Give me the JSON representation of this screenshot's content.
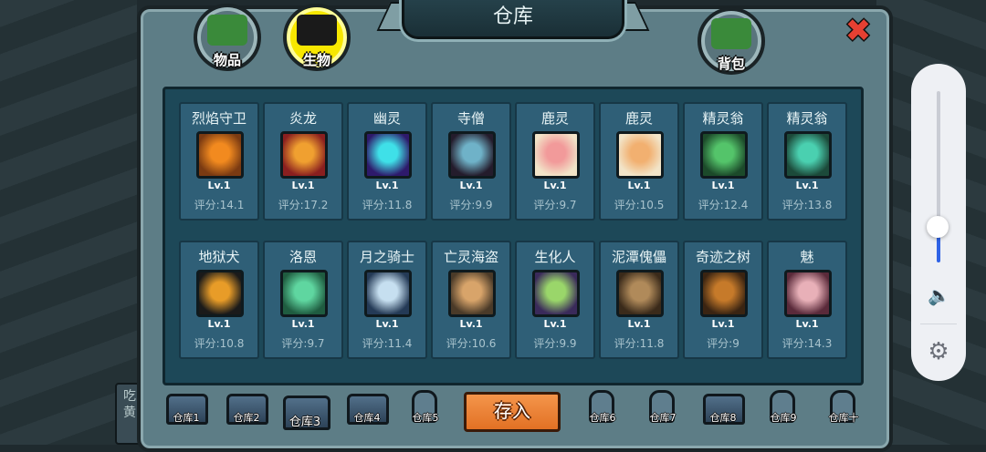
{
  "window": {
    "title": "仓库"
  },
  "tabs": [
    {
      "label": "物品",
      "active": false
    },
    {
      "label": "生物",
      "active": true
    },
    {
      "label": "背包",
      "active": false
    }
  ],
  "side_text": "吃\n黄",
  "creatures": [
    {
      "name": "烈焰守卫",
      "level": "Lv.1",
      "score": "评分:14.1",
      "colors": [
        "#7a3a12",
        "#f28a1f"
      ]
    },
    {
      "name": "炎龙",
      "level": "Lv.1",
      "score": "评分:17.2",
      "colors": [
        "#8a1f1f",
        "#f0a030"
      ]
    },
    {
      "name": "幽灵",
      "level": "Lv.1",
      "score": "评分:11.8",
      "colors": [
        "#2e1a6b",
        "#3fe0e8"
      ]
    },
    {
      "name": "寺僧",
      "level": "Lv.1",
      "score": "评分:9.9",
      "colors": [
        "#241c2c",
        "#6fb2c8"
      ]
    },
    {
      "name": "鹿灵",
      "level": "Lv.1",
      "score": "评分:9.7",
      "colors": [
        "#f2e4c8",
        "#f29a9a"
      ]
    },
    {
      "name": "鹿灵",
      "level": "Lv.1",
      "score": "评分:10.5",
      "colors": [
        "#f2e4c8",
        "#f2b070"
      ]
    },
    {
      "name": "精灵翁",
      "level": "Lv.1",
      "score": "评分:12.4",
      "colors": [
        "#1c4a2a",
        "#54c46a"
      ]
    },
    {
      "name": "精灵翁",
      "level": "Lv.1",
      "score": "评分:13.8",
      "colors": [
        "#1c4a3a",
        "#4ad0b0"
      ]
    },
    {
      "name": "地狱犬",
      "level": "Lv.1",
      "score": "评分:10.8",
      "colors": [
        "#1a1a1a",
        "#e89c28"
      ]
    },
    {
      "name": "洛恩",
      "level": "Lv.1",
      "score": "评分:9.7",
      "colors": [
        "#1f5c40",
        "#5fd6a0"
      ]
    },
    {
      "name": "月之骑士",
      "level": "Lv.1",
      "score": "评分:11.4",
      "colors": [
        "#243a56",
        "#c6dff0"
      ]
    },
    {
      "name": "亡灵海盗",
      "level": "Lv.1",
      "score": "评分:10.6",
      "colors": [
        "#4a3a28",
        "#d8a46a"
      ]
    },
    {
      "name": "生化人",
      "level": "Lv.1",
      "score": "评分:9.9",
      "colors": [
        "#3a2a5a",
        "#9ad66a"
      ]
    },
    {
      "name": "泥潭傀儡",
      "level": "Lv.1",
      "score": "评分:11.8",
      "colors": [
        "#3a2a1a",
        "#b08a5a"
      ]
    },
    {
      "name": "奇迹之树",
      "level": "Lv.1",
      "score": "评分:9",
      "colors": [
        "#3a2412",
        "#c67a2a"
      ]
    },
    {
      "name": "魅",
      "level": "Lv.1",
      "score": "评分:14.3",
      "colors": [
        "#5a2a3a",
        "#e8b0b8"
      ]
    }
  ],
  "storage_tabs": [
    {
      "label": "仓库1",
      "locked": false
    },
    {
      "label": "仓库2",
      "locked": false
    },
    {
      "label": "仓库3",
      "locked": false,
      "active": true
    },
    {
      "label": "仓库4",
      "locked": false
    },
    {
      "label": "仓库5",
      "locked": true
    },
    {
      "label": "仓库6",
      "locked": true
    },
    {
      "label": "仓库7",
      "locked": true
    },
    {
      "label": "仓库8",
      "locked": false
    },
    {
      "label": "仓库9",
      "locked": true
    },
    {
      "label": "仓库十",
      "locked": true
    }
  ],
  "store_button": "存入",
  "volume": {
    "level_percent": 20,
    "icon": "speaker-icon",
    "settings_icon": "gear-icon"
  },
  "colors": {
    "panel": "#5d7d86",
    "card": "#2f5f77",
    "store_button": "#e27124",
    "close": "#e64032"
  }
}
